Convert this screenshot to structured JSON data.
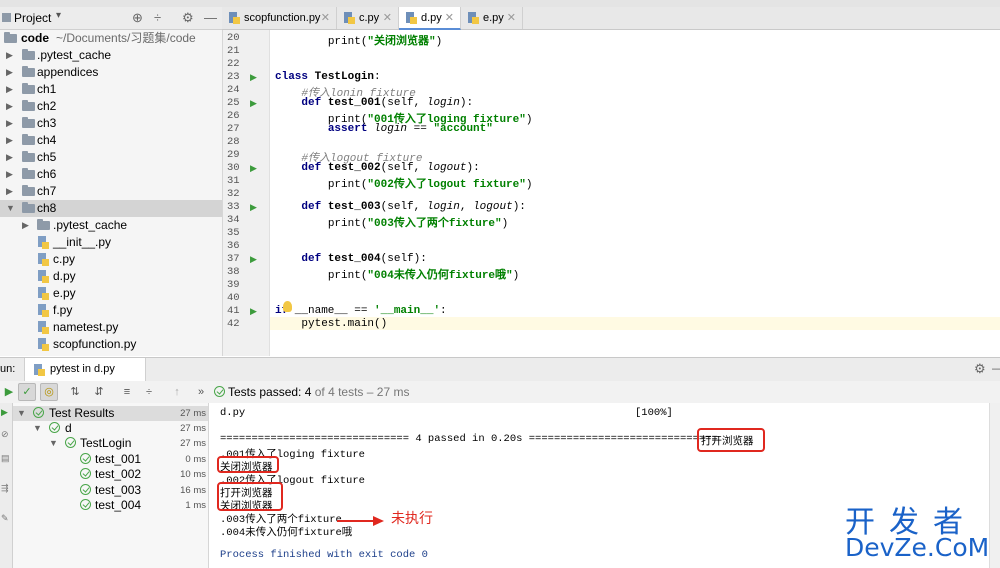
{
  "project_panel": {
    "title": "Project"
  },
  "tabs": [
    {
      "label": "scopfunction.py",
      "active": false
    },
    {
      "label": "c.py",
      "active": false
    },
    {
      "label": "d.py",
      "active": true
    },
    {
      "label": "e.py",
      "active": false
    }
  ],
  "tree": {
    "root": {
      "label": "code",
      "path": "~/Documents/习题集/code"
    },
    "items": [
      ".pytest_cache",
      "appendices",
      "ch1",
      "ch2",
      "ch3",
      "ch4",
      "ch5",
      "ch6",
      "ch7"
    ],
    "ch8": {
      "label": "ch8",
      "children": [
        ".pytest_cache",
        "__init__.py",
        "c.py",
        "d.py",
        "e.py",
        "f.py",
        "nametest.py",
        "scopfunction.py"
      ]
    }
  },
  "editor": {
    "line_numbers": [
      "20",
      "21",
      "22",
      "23",
      "24",
      "25",
      "26",
      "27",
      "28",
      "29",
      "30",
      "31",
      "32",
      "33",
      "34",
      "35",
      "36",
      "37",
      "38",
      "39",
      "40",
      "41",
      "42"
    ],
    "code": {
      "l20_print": "print(",
      "l20_str": "\"关闭浏览器\"",
      "l20_end": ")",
      "l23_kw": "class",
      "l23_name": "TestLogin",
      "l23_end": ":",
      "l24_cmt": "#传入lonin fixture",
      "l25_kw": "def",
      "l25_fn": "test_001",
      "l25_args": "(self, ",
      "l25_prm": "login",
      "l25_end": "):",
      "l26_print": "print(",
      "l26_str": "\"001传入了loging fixture\"",
      "l26_end": ")",
      "l27_kw": "assert",
      "l27_prm": "login",
      "l27_op": " == ",
      "l27_str": "\"account\"",
      "l29_cmt": "#传入logout fixture",
      "l30_kw": "def",
      "l30_fn": "test_002",
      "l30_args": "(self, ",
      "l30_prm": "logout",
      "l30_end": "):",
      "l31_print": "print(",
      "l31_str": "\"002传入了logout fixture\"",
      "l31_end": ")",
      "l33_kw": "def",
      "l33_fn": "test_003",
      "l33_args": "(self, ",
      "l33_prm1": "login",
      "l33_sep": ", ",
      "l33_prm2": "logout",
      "l33_end": "):",
      "l34_print": "print(",
      "l34_str": "\"003传入了两个fixture\"",
      "l34_end": ")",
      "l37_kw": "def",
      "l37_fn": "test_004",
      "l37_args": "(self):",
      "l38_print": "print(",
      "l38_str": "\"004未传入仍何fixture哦\"",
      "l38_end": ")",
      "l41_kw": "if",
      "l41_mid": " __name__ == ",
      "l41_str": "'__main__'",
      "l41_end": ":",
      "l42": "pytest.main()"
    }
  },
  "run": {
    "label": "un:",
    "config": "pytest in d.py",
    "passed_prefix": "Tests passed: ",
    "passed_count": "4",
    "passed_suffix": " of 4 tests – 27 ms"
  },
  "results": [
    {
      "label": "Test Results",
      "time": "27 ms"
    },
    {
      "label": "d",
      "time": "27 ms"
    },
    {
      "label": "TestLogin",
      "time": "27 ms"
    },
    {
      "label": "test_001",
      "time": "0 ms"
    },
    {
      "label": "test_002",
      "time": "10 ms"
    },
    {
      "label": "test_003",
      "time": "16 ms"
    },
    {
      "label": "test_004",
      "time": "1 ms"
    }
  ],
  "console": {
    "l1_file": "d.py",
    "l1_pct": "[100%]",
    "l2": "============================== 4 passed in 0.20s ==============================",
    "l2_tail": "打开浏览器",
    "l3": ".001传入了loging fixture",
    "l4": "关闭浏览器",
    "l5": ".002传入了logout fixture",
    "l6": "打开浏览器",
    "l7": "关闭浏览器",
    "l8": ".003传入了两个fixture",
    "l9": ".004未传入仍何fixture哦",
    "l10": "Process finished with exit code 0",
    "annotation": "未执行"
  },
  "watermark": {
    "top": "开发者",
    "bottom": "DevZe.CoM"
  },
  "colors": {
    "accent_red": "#e0281f",
    "pass_green": "#4aa64a",
    "watermark_blue": "#1a62c8"
  }
}
